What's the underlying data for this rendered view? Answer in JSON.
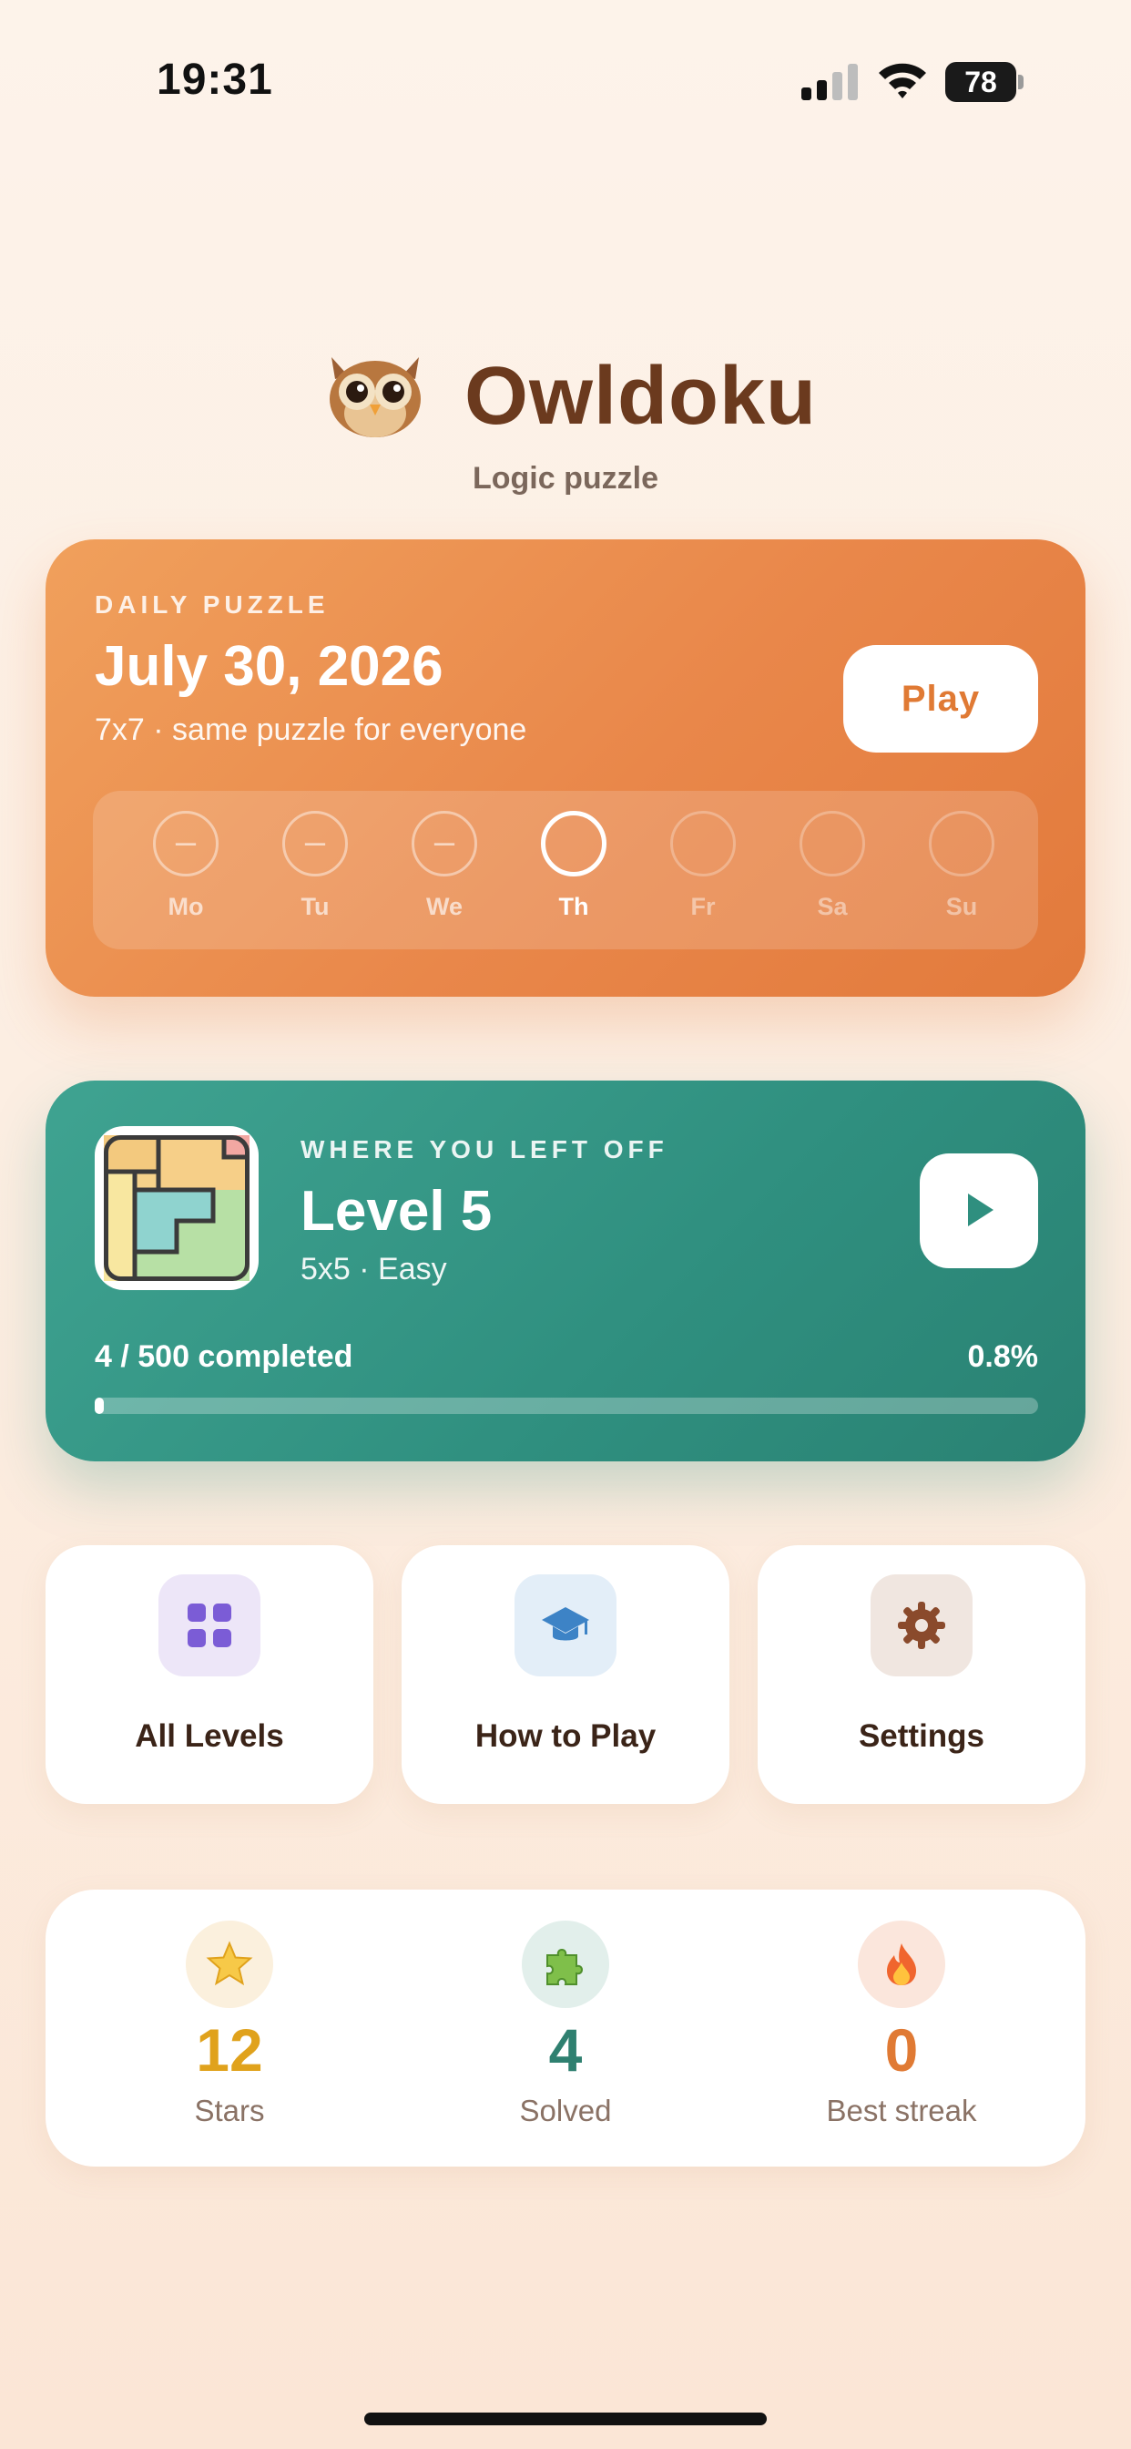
{
  "status_bar": {
    "time": "19:31",
    "battery": "78"
  },
  "header": {
    "title": "Owldoku",
    "subtitle": "Logic puzzle",
    "logo_icon": "owl-logo"
  },
  "daily": {
    "label": "DAILY PUZZLE",
    "date": "July 30, 2026",
    "subtitle": "7x7 · same puzzle for everyone",
    "play_label": "Play",
    "days": [
      {
        "label": "Mo",
        "mark": "–",
        "state": "missed"
      },
      {
        "label": "Tu",
        "mark": "–",
        "state": "missed"
      },
      {
        "label": "We",
        "mark": "–",
        "state": "missed"
      },
      {
        "label": "Th",
        "mark": "",
        "state": "today"
      },
      {
        "label": "Fr",
        "mark": "",
        "state": "future"
      },
      {
        "label": "Sa",
        "mark": "",
        "state": "future"
      },
      {
        "label": "Su",
        "mark": "",
        "state": "future"
      }
    ],
    "colors": {
      "start": "#f0a05c",
      "end": "#e27a3c",
      "play_text": "#e07a34"
    }
  },
  "continue": {
    "label": "WHERE YOU LEFT OFF",
    "level": "Level 5",
    "subtitle": "5x5 · Easy",
    "progress_text": "4 / 500 completed",
    "progress_percent": "0.8%",
    "progress_fraction": 0.008,
    "colors": {
      "start": "#3fa391",
      "end": "#2a8273"
    }
  },
  "tiles": [
    {
      "label": "All Levels",
      "icon": "grid-icon",
      "bg": "#ede6f8",
      "color": "#7b5cd6"
    },
    {
      "label": "How to Play",
      "icon": "graduation-cap-icon",
      "bg": "#e3eef8",
      "color": "#3d83c6"
    },
    {
      "label": "Settings",
      "icon": "gear-icon",
      "bg": "#f0e6e0",
      "color": "#8a4a2c"
    }
  ],
  "stats": [
    {
      "value": "12",
      "label": "Stars",
      "icon": "star-icon",
      "color": "#e0a21c",
      "bg": "#fbf0dd"
    },
    {
      "value": "4",
      "label": "Solved",
      "icon": "puzzle-piece-icon",
      "color": "#2f8070",
      "bg": "#e2efeb"
    },
    {
      "value": "0",
      "label": "Best streak",
      "icon": "fire-icon",
      "color": "#e07a34",
      "bg": "#fbe6dc"
    }
  ]
}
